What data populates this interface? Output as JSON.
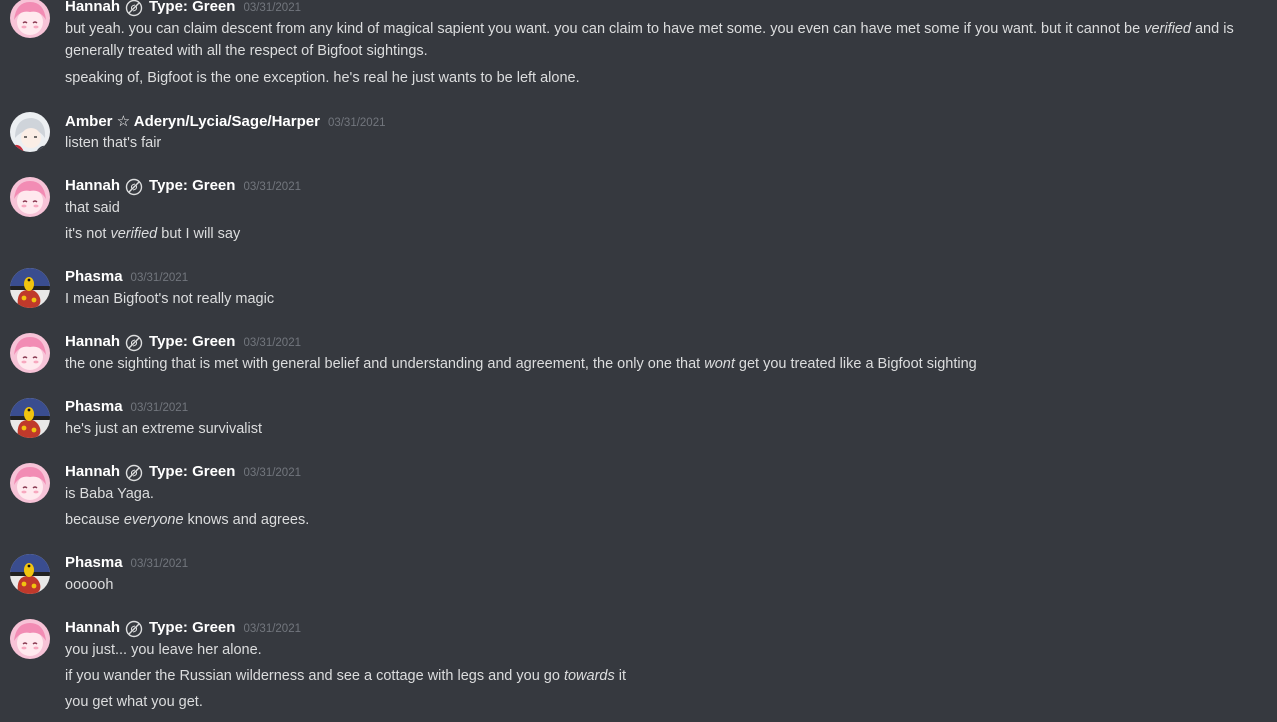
{
  "channel": {
    "users": {
      "hannah": {
        "name": "Hannah",
        "tag": "Type: Green"
      },
      "amber": {
        "name": "Amber ☆ Aderyn/Lycia/Sage/Harper"
      },
      "phasma": {
        "name": "Phasma"
      }
    },
    "messages": [
      {
        "author": "Hannah",
        "tag": "Type: Green",
        "timestamp": "03/31/2021",
        "lines": [
          [
            "but yeah. you can claim descent from any kind of magical sapient you want. you can claim to have met some. you even can have met some if you want. but it cannot be ",
            "verified",
            " and is generally treated with all the respect of Bigfoot sightings."
          ],
          [
            "speaking of, Bigfoot is the one exception. he's real he just wants to be left alone."
          ]
        ]
      },
      {
        "author": "Amber ☆ Aderyn/Lycia/Sage/Harper",
        "timestamp": "03/31/2021",
        "lines": [
          [
            "listen that's fair"
          ]
        ]
      },
      {
        "author": "Hannah",
        "tag": "Type: Green",
        "timestamp": "03/31/2021",
        "lines": [
          [
            "that said"
          ],
          [
            "it's not ",
            "verified",
            " but I will say"
          ]
        ]
      },
      {
        "author": "Phasma",
        "timestamp": "03/31/2021",
        "lines": [
          [
            "I mean Bigfoot's not really magic"
          ]
        ]
      },
      {
        "author": "Hannah",
        "tag": "Type: Green",
        "timestamp": "03/31/2021",
        "lines": [
          [
            "the one sighting that is met with general belief and understanding and agreement, the only one that ",
            "wont",
            " get you treated like a Bigfoot sighting"
          ]
        ]
      },
      {
        "author": "Phasma",
        "timestamp": "03/31/2021",
        "lines": [
          [
            "he's just an extreme survivalist"
          ]
        ]
      },
      {
        "author": "Hannah",
        "tag": "Type: Green",
        "timestamp": "03/31/2021",
        "lines": [
          [
            "is Baba Yaga."
          ],
          [
            "because ",
            "everyone",
            " knows and agrees."
          ]
        ]
      },
      {
        "author": "Phasma",
        "timestamp": "03/31/2021",
        "lines": [
          [
            "oooooh"
          ]
        ]
      },
      {
        "author": "Hannah",
        "tag": "Type: Green",
        "timestamp": "03/31/2021",
        "lines": [
          [
            "you just... you leave her alone."
          ],
          [
            "if you wander the Russian wilderness and see a cottage with legs and you go ",
            "towards",
            " it"
          ],
          [
            "you get what you get."
          ]
        ]
      }
    ]
  },
  "colors": {
    "background": "#36393f",
    "username": "#ffffff",
    "timestamp": "#72767d",
    "message_text": "#dcddde"
  },
  "icons": {
    "type_tag": "grass-type-icon",
    "hannah_avatar": "pink-hair-avatar",
    "amber_avatar": "white-hair-avatar",
    "phasma_avatar": "shuckle-pokeball-avatar"
  }
}
